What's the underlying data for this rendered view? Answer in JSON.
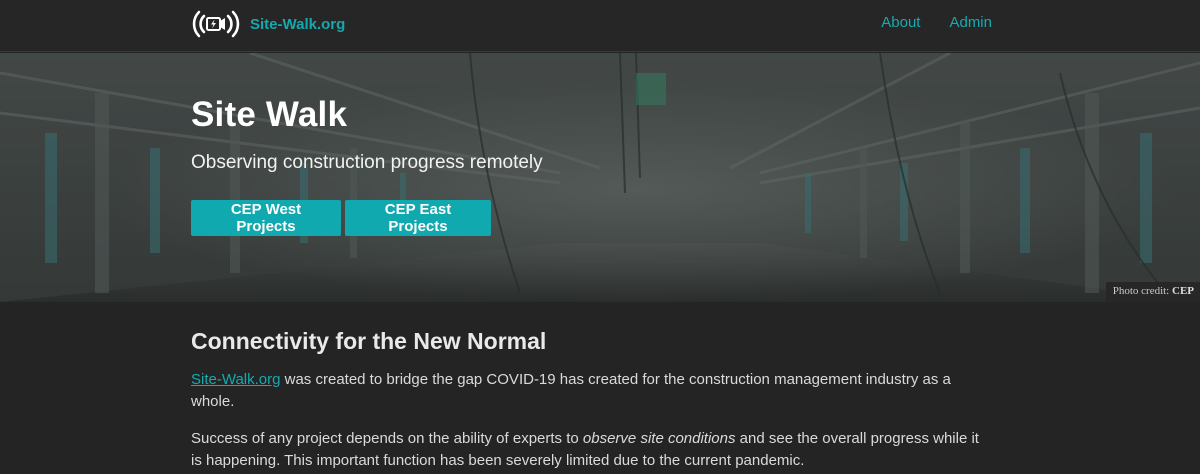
{
  "navbar": {
    "brand": "Site-Walk.org",
    "links": [
      "About",
      "Admin"
    ]
  },
  "hero": {
    "title": "Site Walk",
    "subtitle": "Observing construction progress remotely",
    "buttons": [
      "CEP West Projects",
      "CEP East Projects"
    ],
    "photo_credit_prefix": "Photo credit: ",
    "photo_credit_name": "CEP"
  },
  "content": {
    "heading": "Connectivity for the New Normal",
    "para1_link": "Site-Walk.org",
    "para1_rest": " was created to bridge the gap COVID-19 has created for the construction management industry as a whole.",
    "para2_before": "Success of any project depends on the ability of experts to ",
    "para2_em": "observe site conditions",
    "para2_after": " and see the overall progress while it is happening. This important function has been severely limited due to the current pandemic."
  },
  "colors": {
    "accent": "#10a9b0",
    "page_background": "#242424",
    "navbar_background": "#262626"
  },
  "icons": {
    "brand_logo": "broadcast-camera-icon"
  }
}
